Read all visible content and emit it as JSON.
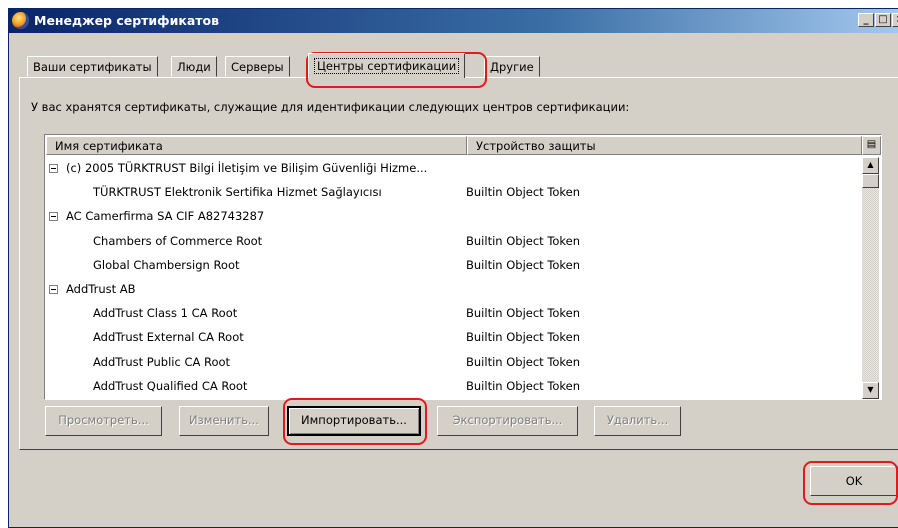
{
  "window": {
    "title": "Менеджер сертификатов",
    "controls": {
      "minimize": "_",
      "maximize": "□",
      "close": "×"
    }
  },
  "tabs": [
    {
      "label": "Ваши сертификаты",
      "active": false
    },
    {
      "label": "Люди",
      "active": false
    },
    {
      "label": "Серверы",
      "active": false
    },
    {
      "label": "Центры сертификации",
      "active": true
    },
    {
      "label": "Другие",
      "active": false
    }
  ],
  "description": "У вас хранятся сертификаты, служащие для идентификации следующих центров сертификации:",
  "tree": {
    "columns": {
      "name": "Имя сертификата",
      "device": "Устройство защиты"
    },
    "column_picker_icon": "column-picker-icon",
    "rows": [
      {
        "type": "group",
        "name": "(c) 2005 TÜRKTRUST Bilgi İletişim ve Bilişim Güvenliği Hizme...",
        "device": ""
      },
      {
        "type": "child",
        "name": "TÜRKTRUST Elektronik Sertifika Hizmet Sağlayıcısı",
        "device": "Builtin Object Token"
      },
      {
        "type": "group",
        "name": "AC Camerfirma SA CIF A82743287",
        "device": ""
      },
      {
        "type": "child",
        "name": "Chambers of Commerce Root",
        "device": "Builtin Object Token"
      },
      {
        "type": "child",
        "name": "Global Chambersign Root",
        "device": "Builtin Object Token"
      },
      {
        "type": "group",
        "name": "AddTrust AB",
        "device": ""
      },
      {
        "type": "child",
        "name": "AddTrust Class 1 CA Root",
        "device": "Builtin Object Token"
      },
      {
        "type": "child",
        "name": "AddTrust External CA Root",
        "device": "Builtin Object Token"
      },
      {
        "type": "child",
        "name": "AddTrust Public CA Root",
        "device": "Builtin Object Token"
      },
      {
        "type": "child",
        "name": "AddTrust Qualified CA Root",
        "device": "Builtin Object Token"
      }
    ]
  },
  "buttons": {
    "view": "Просмотреть...",
    "edit": "Изменить...",
    "import": "Импортировать...",
    "export": "Экспортировать...",
    "delete": "Удалить...",
    "ok": "OK"
  },
  "colors": {
    "annotation": "#e01b1b",
    "titlebar": "#0a246a",
    "face": "#d4d0c8"
  }
}
